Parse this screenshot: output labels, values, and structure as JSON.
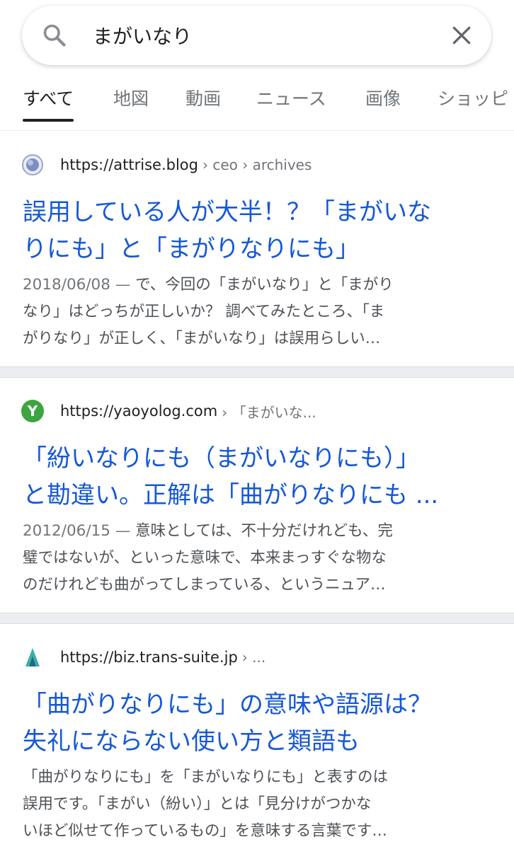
{
  "search": {
    "query": "まがいなり"
  },
  "tabs": [
    {
      "label": "すべて",
      "active": true
    },
    {
      "label": "地図"
    },
    {
      "label": "動画"
    },
    {
      "label": "ニュース"
    },
    {
      "label": "画像"
    },
    {
      "label": "ショッピ"
    }
  ],
  "results": [
    {
      "url": "https://attrise.blog",
      "crumb": "› ceo › archives",
      "title_lines": [
        "誤用している人が大半！？「まがいな",
        "りにも」と「まがりなりにも」"
      ],
      "date": "2018/06/08 —",
      "snippet_lines": [
        "で、今回の「まがいなり」と「まがり",
        "なり」はどっちが正しいか？ 調べてみたところ、「ま",
        "がりなり」が正しく、「まがいなり」は誤用らしい…"
      ]
    },
    {
      "url": "https://yaoyolog.com",
      "crumb": "› 「まがいな...",
      "favicon_letter": "Y",
      "title_lines": [
        "「紛いなりにも（まがいなりにも）」",
        "と勘違い。正解は「曲がりなりにも ..."
      ],
      "date": "2012/06/15 —",
      "snippet_lines": [
        "意味としては、不十分だけれども、完",
        "璧ではないが、といった意味で、本来まっすぐな物な",
        "のだけれども曲がってしまっている、というニュア…"
      ]
    },
    {
      "url": "https://biz.trans-suite.jp",
      "crumb": "› ...",
      "title_lines": [
        "「曲がりなりにも」の意味や語源は？",
        "失礼にならない使い方と類語も"
      ],
      "snippet_lines": [
        "「曲がりなりにも」を「まがいなりにも」と表すのは",
        "誤用です。「まがい（紛い）」とは「見分けがつかな",
        "いほど似せて作っているもの」を意味する言葉です…"
      ]
    }
  ],
  "colors": {
    "link": "#1558d6",
    "text": "#202124",
    "muted": "#70757a",
    "yaoyolog_favicon": "#3da53f",
    "trans_suite_favicon": "#3ab0a3"
  }
}
